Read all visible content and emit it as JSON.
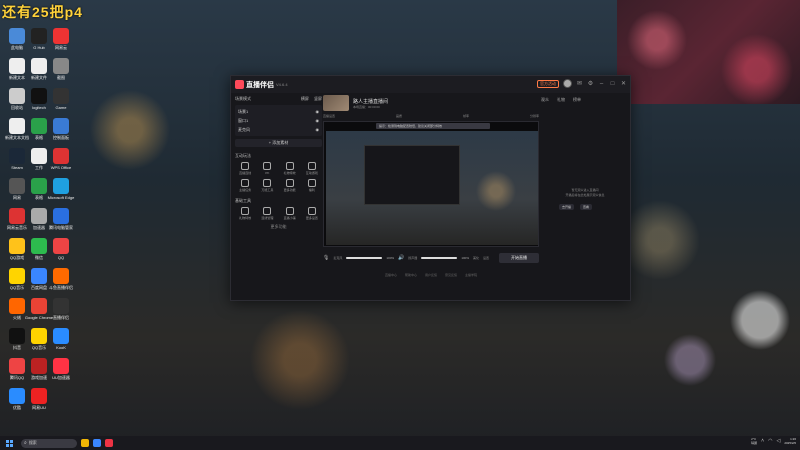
{
  "overlay_text": "还有25把p4",
  "desktop": {
    "icons": [
      {
        "label": "此电脑",
        "color": "#4a8ad8"
      },
      {
        "label": "G Hub",
        "color": "#222"
      },
      {
        "label": "网易云",
        "color": "#e33"
      },
      {
        "label": "新建文本",
        "color": "#eee"
      },
      {
        "label": "新建文件",
        "color": "#eee"
      },
      {
        "label": "截图",
        "color": "#888"
      },
      {
        "label": "回收站",
        "color": "#ccc"
      },
      {
        "label": "logitech",
        "color": "#111"
      },
      {
        "label": "Game",
        "color": "#333"
      },
      {
        "label": "新建文本文档",
        "color": "#eee"
      },
      {
        "label": "表格",
        "color": "#2aa14a"
      },
      {
        "label": "控制面板",
        "color": "#3a7bd5"
      },
      {
        "label": "Steam",
        "color": "#1b2838"
      },
      {
        "label": "工作",
        "color": "#eee"
      },
      {
        "label": "WPS Office",
        "color": "#d33"
      },
      {
        "label": "网易",
        "color": "#555"
      },
      {
        "label": "表格",
        "color": "#2aa14a"
      },
      {
        "label": "Microsoft Edge",
        "color": "#1fa0e0"
      },
      {
        "label": "网易云音乐",
        "color": "#d33"
      },
      {
        "label": "加速器",
        "color": "#aaa"
      },
      {
        "label": "腾讯电脑管家",
        "color": "#2a6fe0"
      },
      {
        "label": "QQ游戏",
        "color": "#ffc21a"
      },
      {
        "label": "微信",
        "color": "#2dbb4e"
      },
      {
        "label": "QQ",
        "color": "#e44"
      },
      {
        "label": "QQ音乐",
        "color": "#ffd400"
      },
      {
        "label": "百度网盘",
        "color": "#3a86ff"
      },
      {
        "label": "斗鱼直播伴侣",
        "color": "#ff6a00"
      },
      {
        "label": "火绒",
        "color": "#f60"
      },
      {
        "label": "Google Chrome",
        "color": "#ea4335"
      },
      {
        "label": "直播伴侣",
        "color": "#333"
      },
      {
        "label": "抖音",
        "color": "#111"
      },
      {
        "label": "QQ音乐",
        "color": "#ffd400"
      },
      {
        "label": "KooK",
        "color": "#2a8cff"
      },
      {
        "label": "腾讯QQ",
        "color": "#e44"
      },
      {
        "label": "游戏加速",
        "color": "#b22"
      },
      {
        "label": "UU加速器",
        "color": "#ff3344"
      },
      {
        "label": "优酷",
        "color": "#2a8cff"
      },
      {
        "label": "网易UU",
        "color": "#e22"
      }
    ]
  },
  "app": {
    "name": "直播伴侣",
    "version": "V4.6.4",
    "official_badge": "官方活动",
    "left_panel": {
      "scene_label": "场景模式",
      "tabs": [
        "横屏",
        "竖屏"
      ],
      "scenes": [
        {
          "name": "场景1",
          "value": ""
        },
        {
          "name": "窗口1",
          "value": ""
        },
        {
          "name": "麦克风",
          "value": ""
        }
      ],
      "add_source": "+ 添加素材",
      "section1": "互动玩法",
      "tools1": [
        "直播连线",
        "PK",
        "礼物特效",
        "互动游戏",
        "主播任务",
        "万能工具",
        "更多功能",
        "福利"
      ],
      "section2": "基础工具",
      "tools2": [
        "礼物特效",
        "连线管理",
        "直播小铺",
        "更多设置"
      ],
      "more": "更多功能"
    },
    "center": {
      "room_title": "路人主播直播间",
      "room_sub": "本场直播：00:00:00",
      "toolbar": [
        "直播设置",
        "画质",
        "帧率",
        "分辨率"
      ],
      "notice": "提示：检测到电脑配置较低，建议关闭部分特效",
      "controls": {
        "mic_label": "麦克风",
        "mic_pct": "100%",
        "mic_value": 1.0,
        "speaker_label": "扬声器",
        "speaker_pct": "100%",
        "speaker_value": 1.0,
        "mode_label": "美化",
        "set_label": "设置",
        "start": "开始直播"
      },
      "footer": [
        "直播中心",
        "帮助中心",
        "用户反馈",
        "意见反馈",
        "主播学院"
      ]
    },
    "right_panel": {
      "tabs": [
        "观众",
        "礼物",
        "榜单"
      ],
      "empty_text": "暂无观众进入直播间",
      "empty_sub": "开播后将在此处展示观众信息",
      "btn1": "去开播",
      "btn2": "查看"
    }
  },
  "taskbar": {
    "search_placeholder": "搜索",
    "weather_temp": "2°C",
    "weather_desc": "晴朗",
    "time": "1:26",
    "date": "2025/2/6",
    "apps": [
      "#f2b705",
      "#3a86ff",
      "#e34"
    ]
  }
}
